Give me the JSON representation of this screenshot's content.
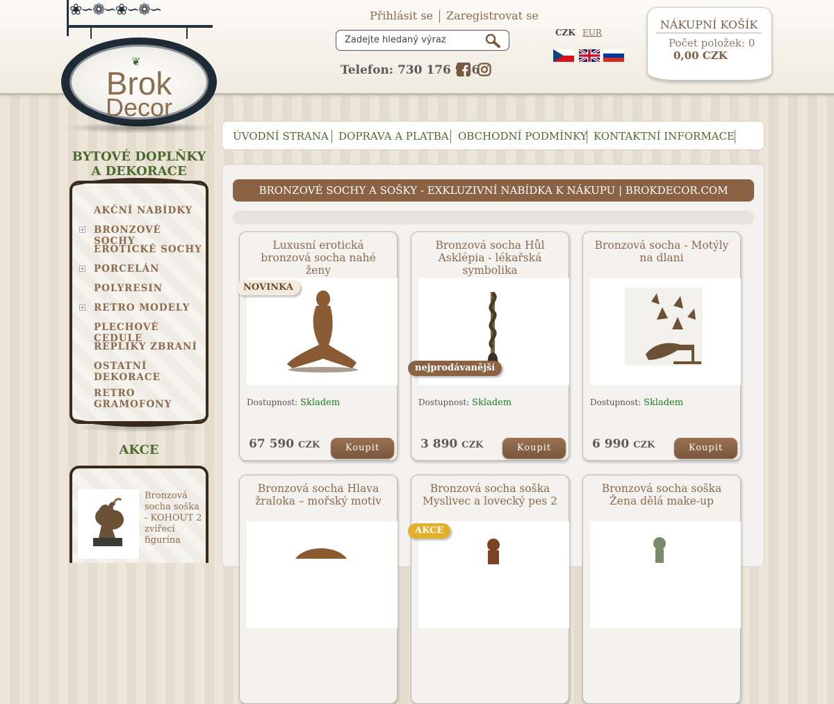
{
  "logo": {
    "line1": "Brok",
    "line2": "Decor"
  },
  "header": {
    "login": "Přihlásit se",
    "register": "Zaregistrovat se",
    "search_placeholder": "Zadejte hledaný výraz",
    "phone": "Telefon: 730 176 966",
    "currencies": [
      "CZK",
      "EUR"
    ],
    "flags": [
      "czech-flag",
      "uk-flag",
      "russia-flag"
    ]
  },
  "cart": {
    "title": "NÁKUPNÍ KOŠÍK",
    "count": "Počet položek: 0",
    "total": "0,00 CZK"
  },
  "nav": [
    "ÚVODNÍ STRANA",
    "DOPRAVA A PLATBA",
    "OBCHODNÍ PODMÍNKY",
    "KONTAKTNÍ INFORMACE"
  ],
  "sidebar": {
    "heading": "BYTOVÉ DOPLŇKY A DEKORACE",
    "items": [
      {
        "label": "AKČNÍ NABÍDKY",
        "expandable": false
      },
      {
        "label": "BRONZOVÉ SOCHY",
        "expandable": true
      },
      {
        "label": "EROTICKÉ SOCHY",
        "expandable": false
      },
      {
        "label": "PORCELÁN",
        "expandable": true
      },
      {
        "label": "POLYRESIN",
        "expandable": false
      },
      {
        "label": "RETRO MODELY",
        "expandable": true
      },
      {
        "label": "PLECHOVÉ CEDULE",
        "expandable": false
      },
      {
        "label": "REPLIKY ZBRANÍ",
        "expandable": false
      },
      {
        "label": "OSTATNÍ DEKORACE",
        "expandable": false
      },
      {
        "label": "RETRO GRAMOFONY",
        "expandable": false
      }
    ],
    "akce_heading": "AKCE",
    "akce_item": "Bronzová socha soška - KOHOUT 2 zvířecí figurína"
  },
  "main": {
    "banner": "BRONZOVÉ SOCHY A SOŠKY - EXKLUZIVNÍ NABÍDKA K NÁKUPU | BROKDECOR.COM",
    "stock_label": "Dostupnost:",
    "buy_label": "Koupit",
    "currency": "CZK",
    "products": [
      {
        "title": "Luxusní erotická bronzová socha nahé ženy",
        "stock": "Skladem",
        "price": "67 590",
        "badge": "NOVINKA",
        "badge_type": "new"
      },
      {
        "title": "Bronzová socha Hůl Asklépia - lékařská symbolika",
        "stock": "Skladem",
        "price": "3 890",
        "badge": "nejprodávanější",
        "badge_type": "top"
      },
      {
        "title": "Bronzová socha - Motýly na dlani",
        "stock": "Skladem",
        "price": "6 990",
        "badge": "",
        "badge_type": ""
      },
      {
        "title": "Bronzová socha Hlava žraloka – mořský motiv",
        "stock": "",
        "price": "",
        "badge": "",
        "badge_type": ""
      },
      {
        "title": "Bronzová socha soška Myslivec a lovecký pes 2",
        "stock": "",
        "price": "",
        "badge": "AKCE",
        "badge_type": "akce"
      },
      {
        "title": "Bronzová socha soška Žena dělá make-up",
        "stock": "",
        "price": "",
        "badge": "",
        "badge_type": ""
      }
    ]
  }
}
